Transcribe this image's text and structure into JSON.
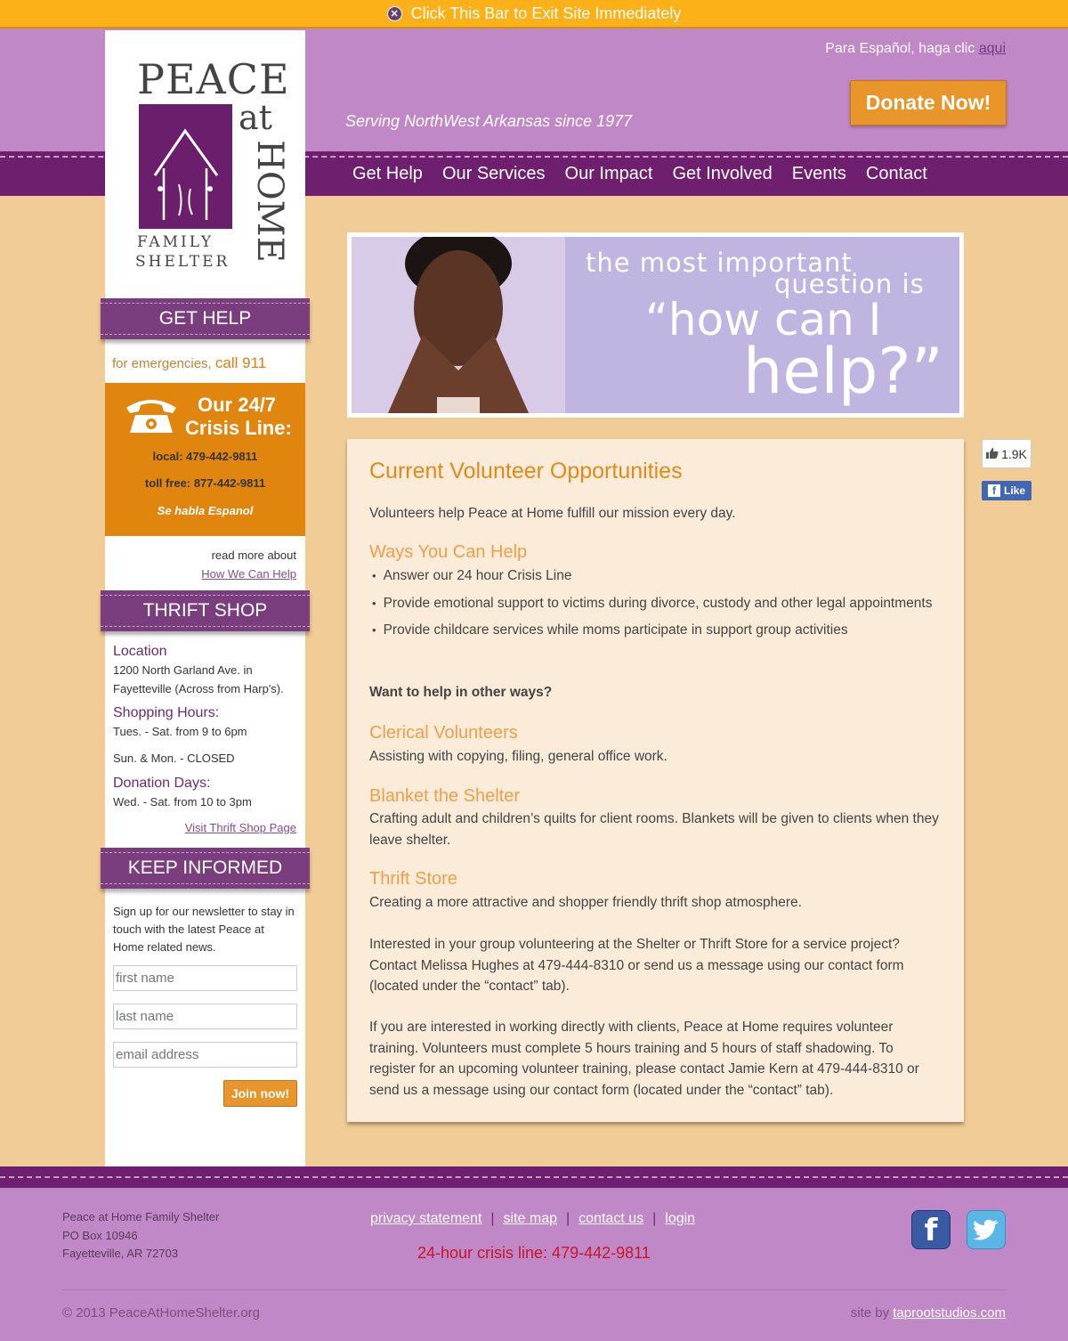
{
  "exit_bar": {
    "label": "Click This Bar to Exit Site Immediately"
  },
  "header": {
    "spanish_prefix": "Para Español, haga clic ",
    "spanish_link": "aqui",
    "tagline": "Serving NorthWest Arkansas since 1977",
    "donate_label": "Donate Now!"
  },
  "logo": {
    "peace": "PEACE",
    "at": "at",
    "home": "HOME",
    "family": "FAMILY",
    "shelter": "SHELTER"
  },
  "nav": {
    "items": [
      "Get Help",
      "Our Services",
      "Our Impact",
      "Get Involved",
      "Events",
      "Contact"
    ]
  },
  "sidebar": {
    "get_help": {
      "heading": "GET HELP",
      "emergency_prefix": "for emergencies, ",
      "emergency_call": "call 911",
      "crisis_title_1": "Our 24/7",
      "crisis_title_2": "Crisis Line:",
      "local": "local: 479-442-9811",
      "tollfree": "toll free: 877-442-9811",
      "spanish": "Se habla Espanol",
      "read_more": "read more about",
      "read_more_link": "How We Can Help"
    },
    "thrift": {
      "heading": "THRIFT SHOP",
      "location_label": "Location",
      "location_1": "1200 North Garland Ave. in",
      "location_2": "Fayetteville (Across from Harp's).",
      "hours_label": "Shopping Hours:",
      "hours_1": "Tues. - Sat. from 9 to 6pm",
      "hours_2": "Sun. & Mon. - CLOSED",
      "donation_label": "Donation Days:",
      "donation_1": "Wed. - Sat. from 10 to 3pm",
      "link": "Visit Thrift Shop Page"
    },
    "keep_informed": {
      "heading": "KEEP INFORMED",
      "text": "Sign up for our newsletter to stay in touch with the latest Peace at Home related news.",
      "first_name_placeholder": "first name",
      "last_name_placeholder": "last name",
      "email_placeholder": "email address",
      "join_label": "Join now!"
    }
  },
  "banner": {
    "line1": "the most important",
    "line2": "question is",
    "line3": "“how can I",
    "line4": "help?”"
  },
  "content": {
    "title": "Current Volunteer Opportunities",
    "intro": "Volunteers help Peace at Home fulfill our mission every day.",
    "ways_heading": "Ways You Can Help",
    "ways": [
      "Answer our 24 hour Crisis Line",
      "Provide emotional support to victims during divorce, custody and other legal appointments",
      "Provide childcare services while moms participate in support group activities"
    ],
    "other_ways": "Want to help in other ways?",
    "clerical_heading": "Clerical Volunteers",
    "clerical_text": "Assisting with copying, filing, general office work.",
    "blanket_heading": "Blanket the Shelter",
    "blanket_text": "Crafting adult and children’s quilts for client rooms.  Blankets will be given to clients when they leave shelter.",
    "thrift_heading": "Thrift Store",
    "thrift_text": "Creating a more attractive and shopper friendly thrift shop atmosphere.",
    "group_text": "Interested in your group volunteering at the Shelter or Thrift Store for a service project? Contact Melissa Hughes at 479-444-8310 or send us a message using our contact form (located under the “contact” tab).",
    "training_text": "If you are interested in working directly with clients, Peace at Home requires volunteer training. Volunteers must complete 5 hours training and 5 hours of staff shadowing. To register for an upcoming volunteer training, please contact Jamie Kern at 479-444-8310 or send us a message using our contact form (located under the “contact” tab)."
  },
  "facebook": {
    "count": "1.9K",
    "like_label": "Like"
  },
  "footer": {
    "address": [
      "Peace at Home Family Shelter",
      "PO Box 10946",
      "Fayetteville, AR 72703"
    ],
    "links": [
      "privacy statement",
      "site map",
      "contact us",
      "login"
    ],
    "crisis": "24-hour crisis line: 479-442-9811",
    "copyright": "© 2013 PeaceAtHomeShelter.org",
    "site_by_prefix": "site by ",
    "site_by_link": "taprootstudios.com"
  },
  "icons": {
    "exit": "close-icon",
    "phone": "telephone-icon",
    "house": "house-icon",
    "facebook": "facebook-icon",
    "twitter": "twitter-icon",
    "thumb": "thumbs-up-icon"
  },
  "colors": {
    "accent_orange": "#e8952a",
    "purple_dark": "#6e1f6e",
    "purple_light": "#c088c6",
    "page_bg": "#f2cc96"
  }
}
